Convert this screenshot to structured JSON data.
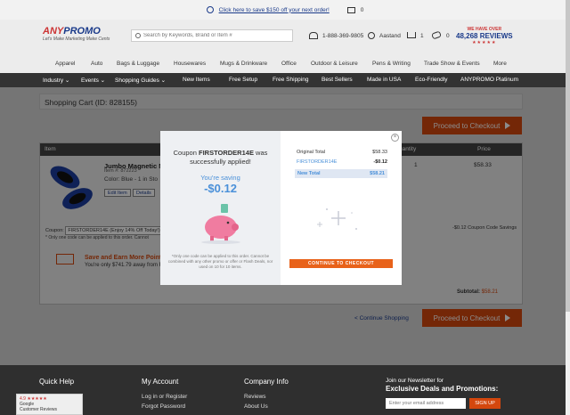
{
  "topbar": {
    "promo": "Click here to save $150 off your next order!",
    "mail_count": "0"
  },
  "header": {
    "logo_name_a": "ANY",
    "logo_name_b": "PROMO",
    "logo_tag": "Let's Make Marketing Make Cents",
    "search_placeholder": "Search by Keywords, Brand or Item #",
    "phone": "1-888-369-9805",
    "user": "Aastand",
    "cart_count": "1",
    "coupon_count": "0",
    "reviews_l1": "WE HAVE OVER",
    "reviews_l2": "48,268 REVIEWS",
    "reviews_stars": "★★★★★"
  },
  "catnav": [
    "Apparel",
    "Auto",
    "Bags & Luggage",
    "Housewares",
    "Mugs & Drinkware",
    "Office",
    "Outdoor & Leisure",
    "Pens & Writing",
    "Trade Show & Events",
    "More"
  ],
  "darknav": [
    "Industry ⌄",
    "Events ⌄",
    "Shopping Guides ⌄",
    "New Items",
    "Free Setup",
    "Free Shipping",
    "Best Sellers",
    "Made in USA",
    "Eco-Friendly",
    "ANYPROMO Platinum"
  ],
  "cart": {
    "title": "Shopping Cart (ID: 828155)",
    "checkout_label": "Proceed to Checkout",
    "table_headers": {
      "item": "Item",
      "quantity": "Quantity",
      "price": "Price"
    },
    "product": {
      "name": "Jumbo Magnetic M",
      "item_no": "Item #: 872223",
      "color": "Color: Blue - 1 in Sto",
      "qty": "1",
      "price": "$58.33",
      "edit_label": "Edit Item",
      "details_label": "Details"
    },
    "coupon_label": "Coupon:",
    "coupon_value": "FIRSTORDER14E (Enjoy 14% Off Today!)",
    "coupon_note": "* Only one code can be applied to this order. Cannot",
    "coupon_savings": "-$0.12 Coupon Code Savings",
    "save_title": "Save and Earn More Point",
    "save_text": "You're only $741.79 away from F",
    "subtotal_label": "Subtotal:",
    "subtotal_value": "$58.21",
    "continue": "< Continue Shopping"
  },
  "modal": {
    "title_pre": "Coupon ",
    "code": "FIRSTORDER14E",
    "title_post": " was successfully applied!",
    "saving_label": "You're saving",
    "saving_amount": "-$0.12",
    "fine_print": "*Only one code can be applied to this order. Cannot be combined with any other promo or offer or Flash Deals, nor used on 10 for 10 items.",
    "close": "×",
    "rows": [
      {
        "label": "Original Total",
        "value": "$58.33"
      },
      {
        "label": "FIRSTORDER14E",
        "value": "-$0.12"
      },
      {
        "label": "New Total",
        "value": "$58.21"
      }
    ],
    "cta": "CONTINUE TO CHECKOUT"
  },
  "footer": {
    "quick_help": "Quick Help",
    "my_account": "My Account",
    "company_info": "Company Info",
    "account_links": [
      "Log in or Register",
      "Forgot Password"
    ],
    "company_links": [
      "Reviews",
      "About Us"
    ],
    "newsletter_l1": "Join our Newsletter for",
    "newsletter_l2": "Exclusive Deals and Promotions:",
    "email_placeholder": "Enter your email address",
    "signup": "SIGN UP"
  },
  "google_badge": {
    "rating": "4.9 ★★★★★",
    "name": "Google",
    "label": "Customer Reviews"
  },
  "colors": {
    "accent": "#d4470d",
    "brand_blue": "#1a3a8a",
    "saving_blue": "#4a90d9"
  }
}
